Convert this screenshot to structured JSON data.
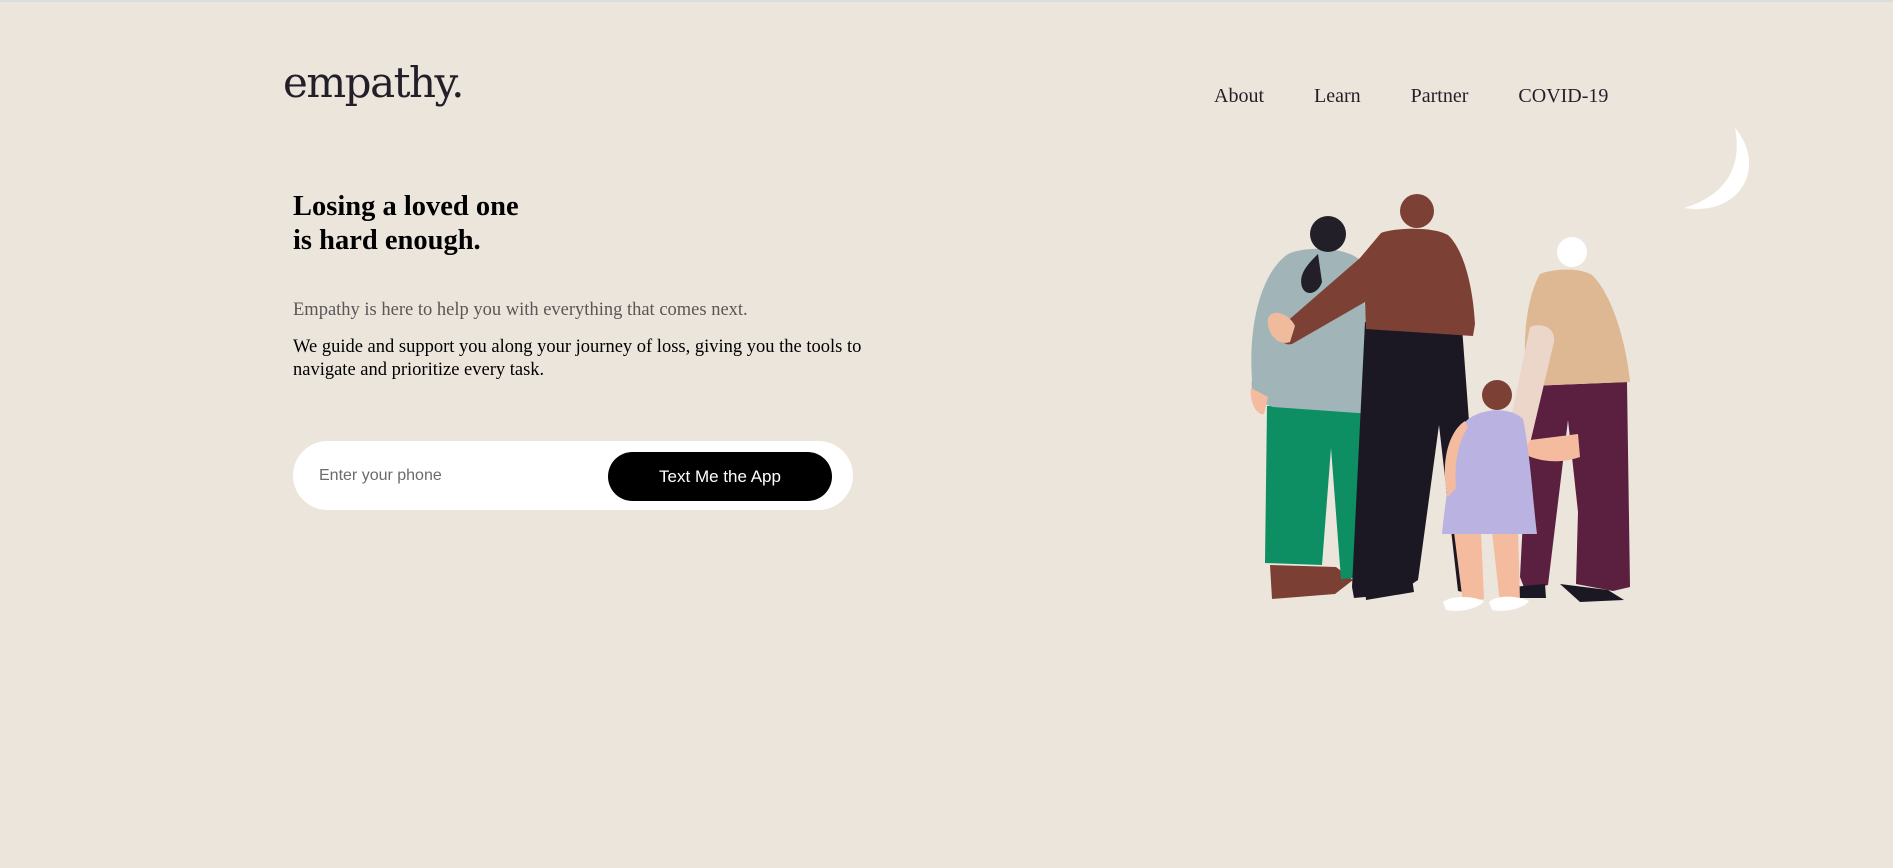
{
  "brand": {
    "logo_text": "empathy."
  },
  "nav": {
    "items": [
      {
        "label": "About"
      },
      {
        "label": "Learn"
      },
      {
        "label": "Partner"
      },
      {
        "label": "COVID-19"
      }
    ]
  },
  "hero": {
    "headline_line1": "Losing a loved one",
    "headline_line2": "is hard enough.",
    "subheading": "Empathy is here to help you with everything that comes next.",
    "description": "We guide and support you along your journey of loss, giving you the tools to navigate and prioritize every task."
  },
  "signup": {
    "phone_placeholder": "Enter your phone",
    "phone_value": "",
    "button_label": "Text Me the App"
  },
  "illustration": {
    "moon_icon": "crescent-moon-icon",
    "figures": [
      "adult-grey-sweater",
      "adult-brown-shirt",
      "child-lavender-dress",
      "elder-tan-shirt"
    ]
  },
  "colors": {
    "background": "#ece5dc",
    "text_dark": "#231f28",
    "button_bg": "#000000",
    "input_bg": "#ffffff"
  }
}
